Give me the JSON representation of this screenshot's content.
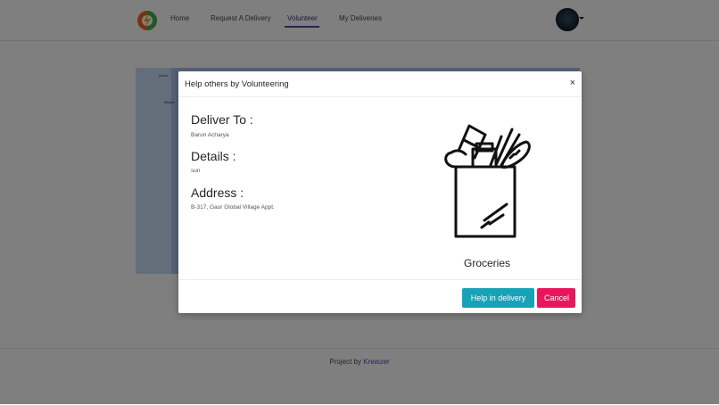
{
  "navbar": {
    "links": [
      {
        "label": "Home",
        "active": false
      },
      {
        "label": "Request A Delivery",
        "active": false
      },
      {
        "label": "Volunteer",
        "active": true
      },
      {
        "label": "My Deliveries",
        "active": false
      }
    ]
  },
  "map": {
    "labels": [
      "Kochi",
      "Bhuter"
    ]
  },
  "footer": {
    "prefix": "Project by",
    "author": "Krewzer"
  },
  "modal": {
    "title": "Help others by Volunteering",
    "close_symbol": "×",
    "deliver_to_label": "Deliver To :",
    "deliver_to_value": "Barun Acharya",
    "details_label": "Details :",
    "details_value": "sun",
    "address_label": "Address :",
    "address_value": "B-317, Gaur Global Village Appt.",
    "item_icon": "grocery-bag-icon",
    "item_name": "Groceries",
    "help_button": "Help in delivery",
    "cancel_button": "Cancel"
  },
  "colors": {
    "accent": "#5a3fb0",
    "help_button": "#17a2b8",
    "cancel_button": "#e8175d"
  }
}
